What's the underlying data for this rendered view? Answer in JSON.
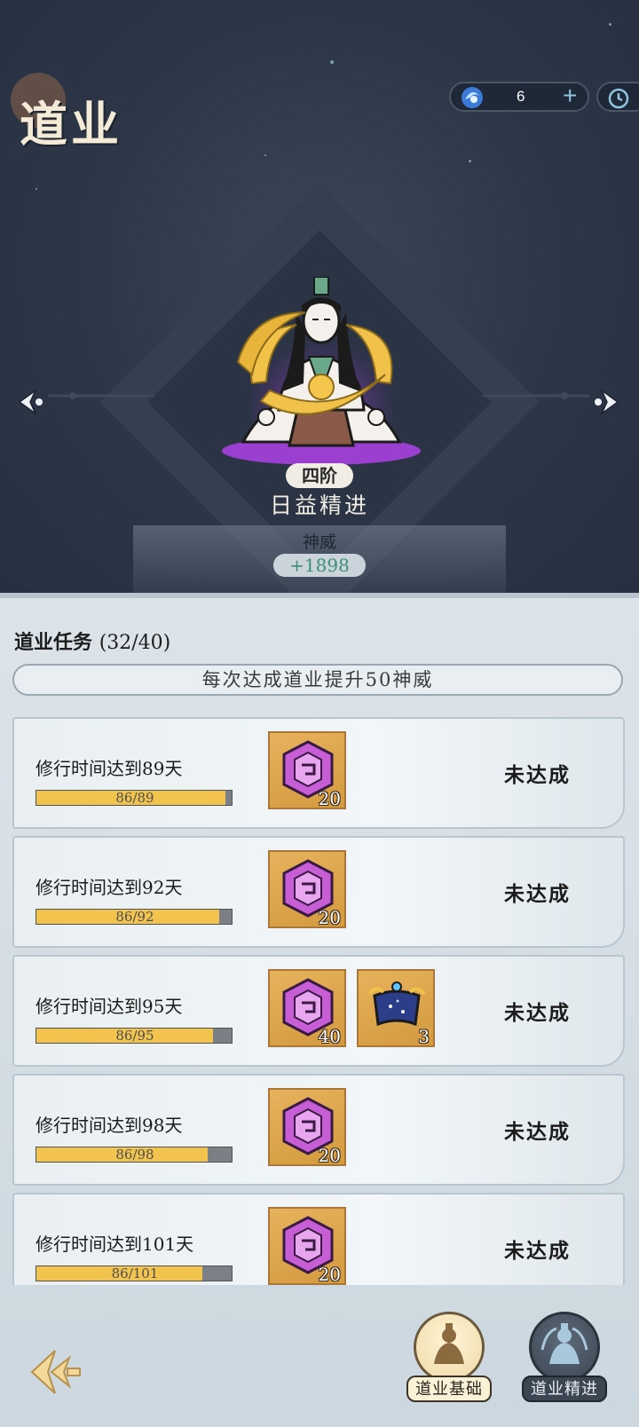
{
  "header": {
    "title": "道业",
    "currency_value": "6",
    "currency_plus": "+"
  },
  "hero": {
    "stage_badge": "四阶",
    "stage_name": "日益精进",
    "stat_label": "神威",
    "stat_value": "+1898"
  },
  "tasks_section": {
    "title": "道业任务",
    "count": "(32/40)",
    "banner": "每次达成道业提升50神威",
    "items": [
      {
        "name": "修行时间达到89天",
        "progress_text": "86/89",
        "progress": 0.966,
        "rewards": [
          {
            "icon": "purple-rune-icon",
            "qty": "20"
          }
        ],
        "status": "未达成"
      },
      {
        "name": "修行时间达到92天",
        "progress_text": "86/92",
        "progress": 0.935,
        "rewards": [
          {
            "icon": "purple-rune-icon",
            "qty": "20"
          }
        ],
        "status": "未达成"
      },
      {
        "name": "修行时间达到95天",
        "progress_text": "86/95",
        "progress": 0.905,
        "rewards": [
          {
            "icon": "purple-rune-icon",
            "qty": "40"
          },
          {
            "icon": "cosmic-scroll-icon",
            "qty": "3"
          }
        ],
        "status": "未达成"
      },
      {
        "name": "修行时间达到98天",
        "progress_text": "86/98",
        "progress": 0.878,
        "rewards": [
          {
            "icon": "purple-rune-icon",
            "qty": "20"
          }
        ],
        "status": "未达成"
      },
      {
        "name": "修行时间达到101天",
        "progress_text": "86/101",
        "progress": 0.851,
        "rewards": [
          {
            "icon": "purple-rune-icon",
            "qty": "20"
          }
        ],
        "status": "未达成"
      }
    ]
  },
  "bottom_nav": {
    "basic_label": "道业基础",
    "advanced_label": "道业精进"
  },
  "colors": {
    "progress_fill": "#f2c44e",
    "stat_green": "#3e8f78",
    "aura_purple": "#9b3fd0"
  }
}
